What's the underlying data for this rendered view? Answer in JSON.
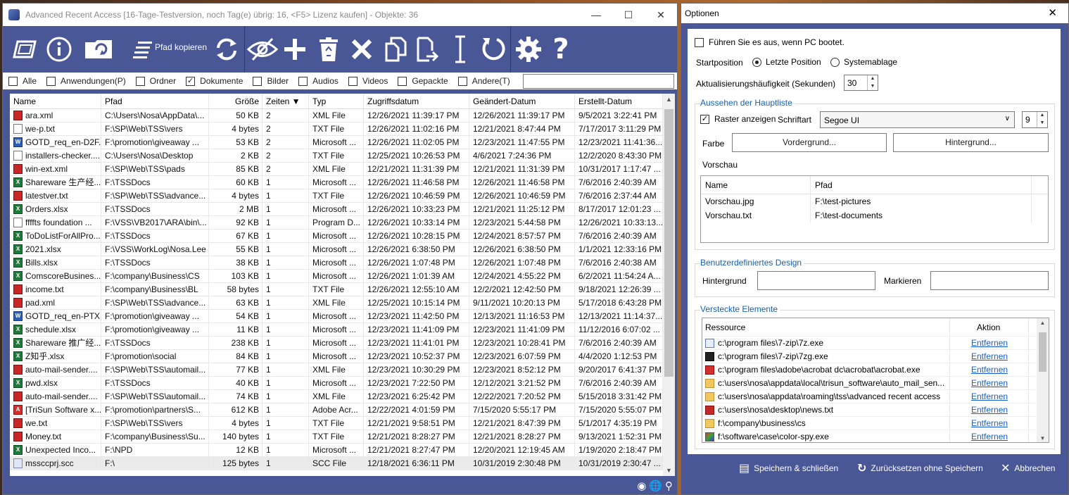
{
  "main": {
    "title": "Advanced Recent Access [16-Tage-Testversion, noch Tag(e) übrig: 16, <F5> Lizenz kaufen] - Objekte: 36",
    "toolbar": {
      "copy_path_label": "Pfad kopieren"
    },
    "filters": [
      {
        "label": "Alle",
        "checked": false
      },
      {
        "label": "Anwendungen(P)",
        "checked": false
      },
      {
        "label": "Ordner",
        "checked": false
      },
      {
        "label": "Dokumente",
        "checked": true
      },
      {
        "label": "Bilder",
        "checked": false
      },
      {
        "label": "Audios",
        "checked": false
      },
      {
        "label": "Videos",
        "checked": false
      },
      {
        "label": "Gepackte",
        "checked": false
      },
      {
        "label": "Andere(T)",
        "checked": false
      }
    ],
    "columns": [
      "Name",
      "Pfad",
      "Größe",
      "Zeiten ▼",
      "Typ",
      "Zugriffsdatum",
      "Geändert-Datum",
      "Erstellt-Datum"
    ],
    "rows": [
      {
        "icon": "xml",
        "name": "ara.xml",
        "path": "C:\\Users\\Nosa\\AppData\\...",
        "size": "50 KB",
        "times": "2",
        "type": "XML File",
        "accessed": "12/26/2021 11:39:17 PM",
        "modified": "12/26/2021 11:39:17 PM",
        "created": "9/5/2021 3:22:41 PM"
      },
      {
        "icon": "txt",
        "name": "we-p.txt",
        "path": "F:\\SP\\Web\\TSS\\vers",
        "size": "4 bytes",
        "times": "2",
        "type": "TXT File",
        "accessed": "12/26/2021 11:02:16 PM",
        "modified": "12/21/2021 8:47:44 PM",
        "created": "7/17/2017 3:11:29 PM"
      },
      {
        "icon": "doc",
        "name": "GOTD_req_en-D2F...",
        "path": "F:\\promotion\\giveaway ...",
        "size": "53 KB",
        "times": "2",
        "type": "Microsoft ...",
        "accessed": "12/26/2021 11:02:05 PM",
        "modified": "12/23/2021 11:47:55 PM",
        "created": "12/23/2021 11:41:36..."
      },
      {
        "icon": "txt",
        "name": "installers-checker....",
        "path": "C:\\Users\\Nosa\\Desktop",
        "size": "2 KB",
        "times": "2",
        "type": "TXT File",
        "accessed": "12/25/2021 10:26:53 PM",
        "modified": "4/6/2021 7:24:36 PM",
        "created": "12/2/2020 8:43:30 PM"
      },
      {
        "icon": "xml",
        "name": "win-ext.xml",
        "path": "F:\\SP\\Web\\TSS\\pads",
        "size": "85 KB",
        "times": "2",
        "type": "XML File",
        "accessed": "12/21/2021 11:31:39 PM",
        "modified": "12/21/2021 11:31:39 PM",
        "created": "10/31/2017 1:17:47 ..."
      },
      {
        "icon": "xls",
        "name": "Shareware 生产经...",
        "path": "F:\\TSSDocs",
        "size": "60 KB",
        "times": "1",
        "type": "Microsoft ...",
        "accessed": "12/26/2021 11:46:58 PM",
        "modified": "12/26/2021 11:46:58 PM",
        "created": "7/6/2016 2:40:39 AM"
      },
      {
        "icon": "xml",
        "name": "latestver.txt",
        "path": "F:\\SP\\Web\\TSS\\advance...",
        "size": "4 bytes",
        "times": "1",
        "type": "TXT File",
        "accessed": "12/26/2021 10:46:59 PM",
        "modified": "12/26/2021 10:46:59 PM",
        "created": "7/6/2016 2:37:44 AM"
      },
      {
        "icon": "xls",
        "name": "Orders.xlsx",
        "path": "F:\\TSSDocs",
        "size": "2 MB",
        "times": "1",
        "type": "Microsoft ...",
        "accessed": "12/26/2021 10:33:23 PM",
        "modified": "12/21/2021 11:25:12 PM",
        "created": "8/17/2017 12:01:23 ..."
      },
      {
        "icon": "txt",
        "name": "ffffts foundation ...",
        "path": "F:\\VSS\\VB2017\\ARA\\bin\\...",
        "size": "92 KB",
        "times": "1",
        "type": "Program D...",
        "accessed": "12/26/2021 10:33:14 PM",
        "modified": "12/23/2021 5:44:58 PM",
        "created": "12/26/2021 10:33:13..."
      },
      {
        "icon": "xls",
        "name": "ToDoListForAllPro...",
        "path": "F:\\TSSDocs",
        "size": "67 KB",
        "times": "1",
        "type": "Microsoft ...",
        "accessed": "12/26/2021 10:28:15 PM",
        "modified": "12/24/2021 8:57:57 PM",
        "created": "7/6/2016 2:40:39 AM"
      },
      {
        "icon": "xls",
        "name": "2021.xlsx",
        "path": "F:\\VSS\\WorkLog\\Nosa.Lee",
        "size": "55 KB",
        "times": "1",
        "type": "Microsoft ...",
        "accessed": "12/26/2021 6:38:50 PM",
        "modified": "12/26/2021 6:38:50 PM",
        "created": "1/1/2021 12:33:16 PM"
      },
      {
        "icon": "xls",
        "name": "Bills.xlsx",
        "path": "F:\\TSSDocs",
        "size": "38 KB",
        "times": "1",
        "type": "Microsoft ...",
        "accessed": "12/26/2021 1:07:48 PM",
        "modified": "12/26/2021 1:07:48 PM",
        "created": "7/6/2016 2:40:38 AM"
      },
      {
        "icon": "xls",
        "name": "ComscoreBusines...",
        "path": "F:\\company\\Business\\CS",
        "size": "103 KB",
        "times": "1",
        "type": "Microsoft ...",
        "accessed": "12/26/2021 1:01:39 AM",
        "modified": "12/24/2021 4:55:22 PM",
        "created": "6/2/2021 11:54:24 A..."
      },
      {
        "icon": "xml",
        "name": "income.txt",
        "path": "F:\\company\\Business\\BL",
        "size": "58 bytes",
        "times": "1",
        "type": "TXT File",
        "accessed": "12/26/2021 12:55:10 AM",
        "modified": "12/2/2021 12:42:50 PM",
        "created": "9/18/2021 12:26:39 ..."
      },
      {
        "icon": "xml",
        "name": "pad.xml",
        "path": "F:\\SP\\Web\\TSS\\advance...",
        "size": "63 KB",
        "times": "1",
        "type": "XML File",
        "accessed": "12/25/2021 10:15:14 PM",
        "modified": "9/11/2021 10:20:13 PM",
        "created": "5/17/2018 6:43:28 PM"
      },
      {
        "icon": "doc",
        "name": "GOTD_req_en-PTX...",
        "path": "F:\\promotion\\giveaway ...",
        "size": "54 KB",
        "times": "1",
        "type": "Microsoft ...",
        "accessed": "12/23/2021 11:42:50 PM",
        "modified": "12/13/2021 11:16:53 PM",
        "created": "12/13/2021 11:14:37..."
      },
      {
        "icon": "xls",
        "name": "schedule.xlsx",
        "path": "F:\\promotion\\giveaway ...",
        "size": "11 KB",
        "times": "1",
        "type": "Microsoft ...",
        "accessed": "12/23/2021 11:41:09 PM",
        "modified": "12/23/2021 11:41:09 PM",
        "created": "11/12/2016 6:07:02 ..."
      },
      {
        "icon": "xls",
        "name": "Shareware 推广经...",
        "path": "F:\\TSSDocs",
        "size": "238 KB",
        "times": "1",
        "type": "Microsoft ...",
        "accessed": "12/23/2021 11:41:01 PM",
        "modified": "12/23/2021 10:28:41 PM",
        "created": "7/6/2016 2:40:39 AM"
      },
      {
        "icon": "xls",
        "name": "Z知乎.xlsx",
        "path": "F:\\promotion\\social",
        "size": "84 KB",
        "times": "1",
        "type": "Microsoft ...",
        "accessed": "12/23/2021 10:52:37 PM",
        "modified": "12/23/2021 6:07:59 PM",
        "created": "4/4/2020 1:12:53 PM"
      },
      {
        "icon": "xml",
        "name": "auto-mail-sender....",
        "path": "F:\\SP\\Web\\TSS\\automail...",
        "size": "77 KB",
        "times": "1",
        "type": "XML File",
        "accessed": "12/23/2021 10:30:29 PM",
        "modified": "12/23/2021 8:52:12 PM",
        "created": "9/20/2017 6:41:37 PM"
      },
      {
        "icon": "xls",
        "name": "pwd.xlsx",
        "path": "F:\\TSSDocs",
        "size": "40 KB",
        "times": "1",
        "type": "Microsoft ...",
        "accessed": "12/23/2021 7:22:50 PM",
        "modified": "12/12/2021 3:21:52 PM",
        "created": "7/6/2016 2:40:39 AM"
      },
      {
        "icon": "xml",
        "name": "auto-mail-sender....",
        "path": "F:\\SP\\Web\\TSS\\automail...",
        "size": "74 KB",
        "times": "1",
        "type": "XML File",
        "accessed": "12/23/2021 6:25:42 PM",
        "modified": "12/22/2021 7:20:52 PM",
        "created": "5/15/2018 3:31:42 PM"
      },
      {
        "icon": "pdf",
        "name": "[TriSun Software x...",
        "path": "F:\\promotion\\partners\\S...",
        "size": "612 KB",
        "times": "1",
        "type": "Adobe Acr...",
        "accessed": "12/22/2021 4:01:59 PM",
        "modified": "7/15/2020 5:55:17 PM",
        "created": "7/15/2020 5:55:07 PM"
      },
      {
        "icon": "xml",
        "name": "we.txt",
        "path": "F:\\SP\\Web\\TSS\\vers",
        "size": "4 bytes",
        "times": "1",
        "type": "TXT File",
        "accessed": "12/21/2021 9:58:51 PM",
        "modified": "12/21/2021 8:47:39 PM",
        "created": "5/1/2017 4:35:19 PM"
      },
      {
        "icon": "xml",
        "name": "Money.txt",
        "path": "F:\\company\\Business\\Su...",
        "size": "140 bytes",
        "times": "1",
        "type": "TXT File",
        "accessed": "12/21/2021 8:28:27 PM",
        "modified": "12/21/2021 8:28:27 PM",
        "created": "9/13/2021 1:52:31 PM"
      },
      {
        "icon": "xls",
        "name": "Unexpected Inco...",
        "path": "F:\\NPD",
        "size": "12 KB",
        "times": "1",
        "type": "Microsoft ...",
        "accessed": "12/21/2021 8:27:47 PM",
        "modified": "12/20/2021 12:19:45 AM",
        "created": "1/19/2020 2:18:47 PM"
      },
      {
        "icon": "scc",
        "name": "mssccprj.scc",
        "path": "F:\\",
        "size": "125 bytes",
        "times": "1",
        "type": "SCC File",
        "accessed": "12/18/2021 6:36:11 PM",
        "modified": "10/31/2019 2:30:48 PM",
        "created": "10/31/2019 2:30:47 ..."
      }
    ]
  },
  "options": {
    "title": "Optionen",
    "run_on_boot": "Führen Sie es aus, wenn PC bootet.",
    "start_position_label": "Startposition",
    "start_position_last": "Letzte Position",
    "start_position_tray": "Systemablage",
    "refresh_label": "Aktualisierungshäufigkeit (Sekunden)",
    "refresh_value": "30",
    "look_group": "Aussehen der Hauptliste",
    "show_grid": "Raster anzeigen",
    "font_label": "Schriftart",
    "font_value": "Segoe UI",
    "font_size": "9",
    "color_label": "Farbe",
    "fg_button": "Vordergrund...",
    "bg_button": "Hintergrund...",
    "preview_label": "Vorschau",
    "preview_cols": [
      "Name",
      "Pfad"
    ],
    "preview_rows": [
      {
        "name": "Vorschau.jpg",
        "path": "F:\\test-pictures"
      },
      {
        "name": "Vorschau.txt",
        "path": "F:\\test-documents"
      }
    ],
    "custom_group": "Benutzerdefiniertes Design",
    "custom_bg": "Hintergrund",
    "custom_mark": "Markieren",
    "hidden_group": "Versteckte Elemente",
    "hidden_cols": [
      "Ressource",
      "Aktion"
    ],
    "hidden_rows": [
      {
        "icon": "exe",
        "path": "c:\\program files\\7-zip\\7z.exe",
        "action": "Entfernen"
      },
      {
        "icon": "7zg",
        "path": "c:\\program files\\7-zip\\7zg.exe",
        "action": "Entfernen"
      },
      {
        "icon": "pdf",
        "path": "c:\\program files\\adobe\\acrobat dc\\acrobat\\acrobat.exe",
        "action": "Entfernen"
      },
      {
        "icon": "folder",
        "path": "c:\\users\\nosa\\appdata\\local\\trisun_software\\auto_mail_sen...",
        "action": "Entfernen"
      },
      {
        "icon": "folder",
        "path": "c:\\users\\nosa\\appdata\\roaming\\tss\\advanced recent access",
        "action": "Entfernen"
      },
      {
        "icon": "xml",
        "path": "c:\\users\\nosa\\desktop\\news.txt",
        "action": "Entfernen"
      },
      {
        "icon": "folder",
        "path": "f:\\company\\business\\cs",
        "action": "Entfernen"
      },
      {
        "icon": "color",
        "path": "f:\\software\\case\\color-spy.exe",
        "action": "Entfernen"
      }
    ],
    "save_close": "Speichern & schließen",
    "reset_no_save": "Zurücksetzen ohne Speichern",
    "cancel": "Abbrechen"
  }
}
